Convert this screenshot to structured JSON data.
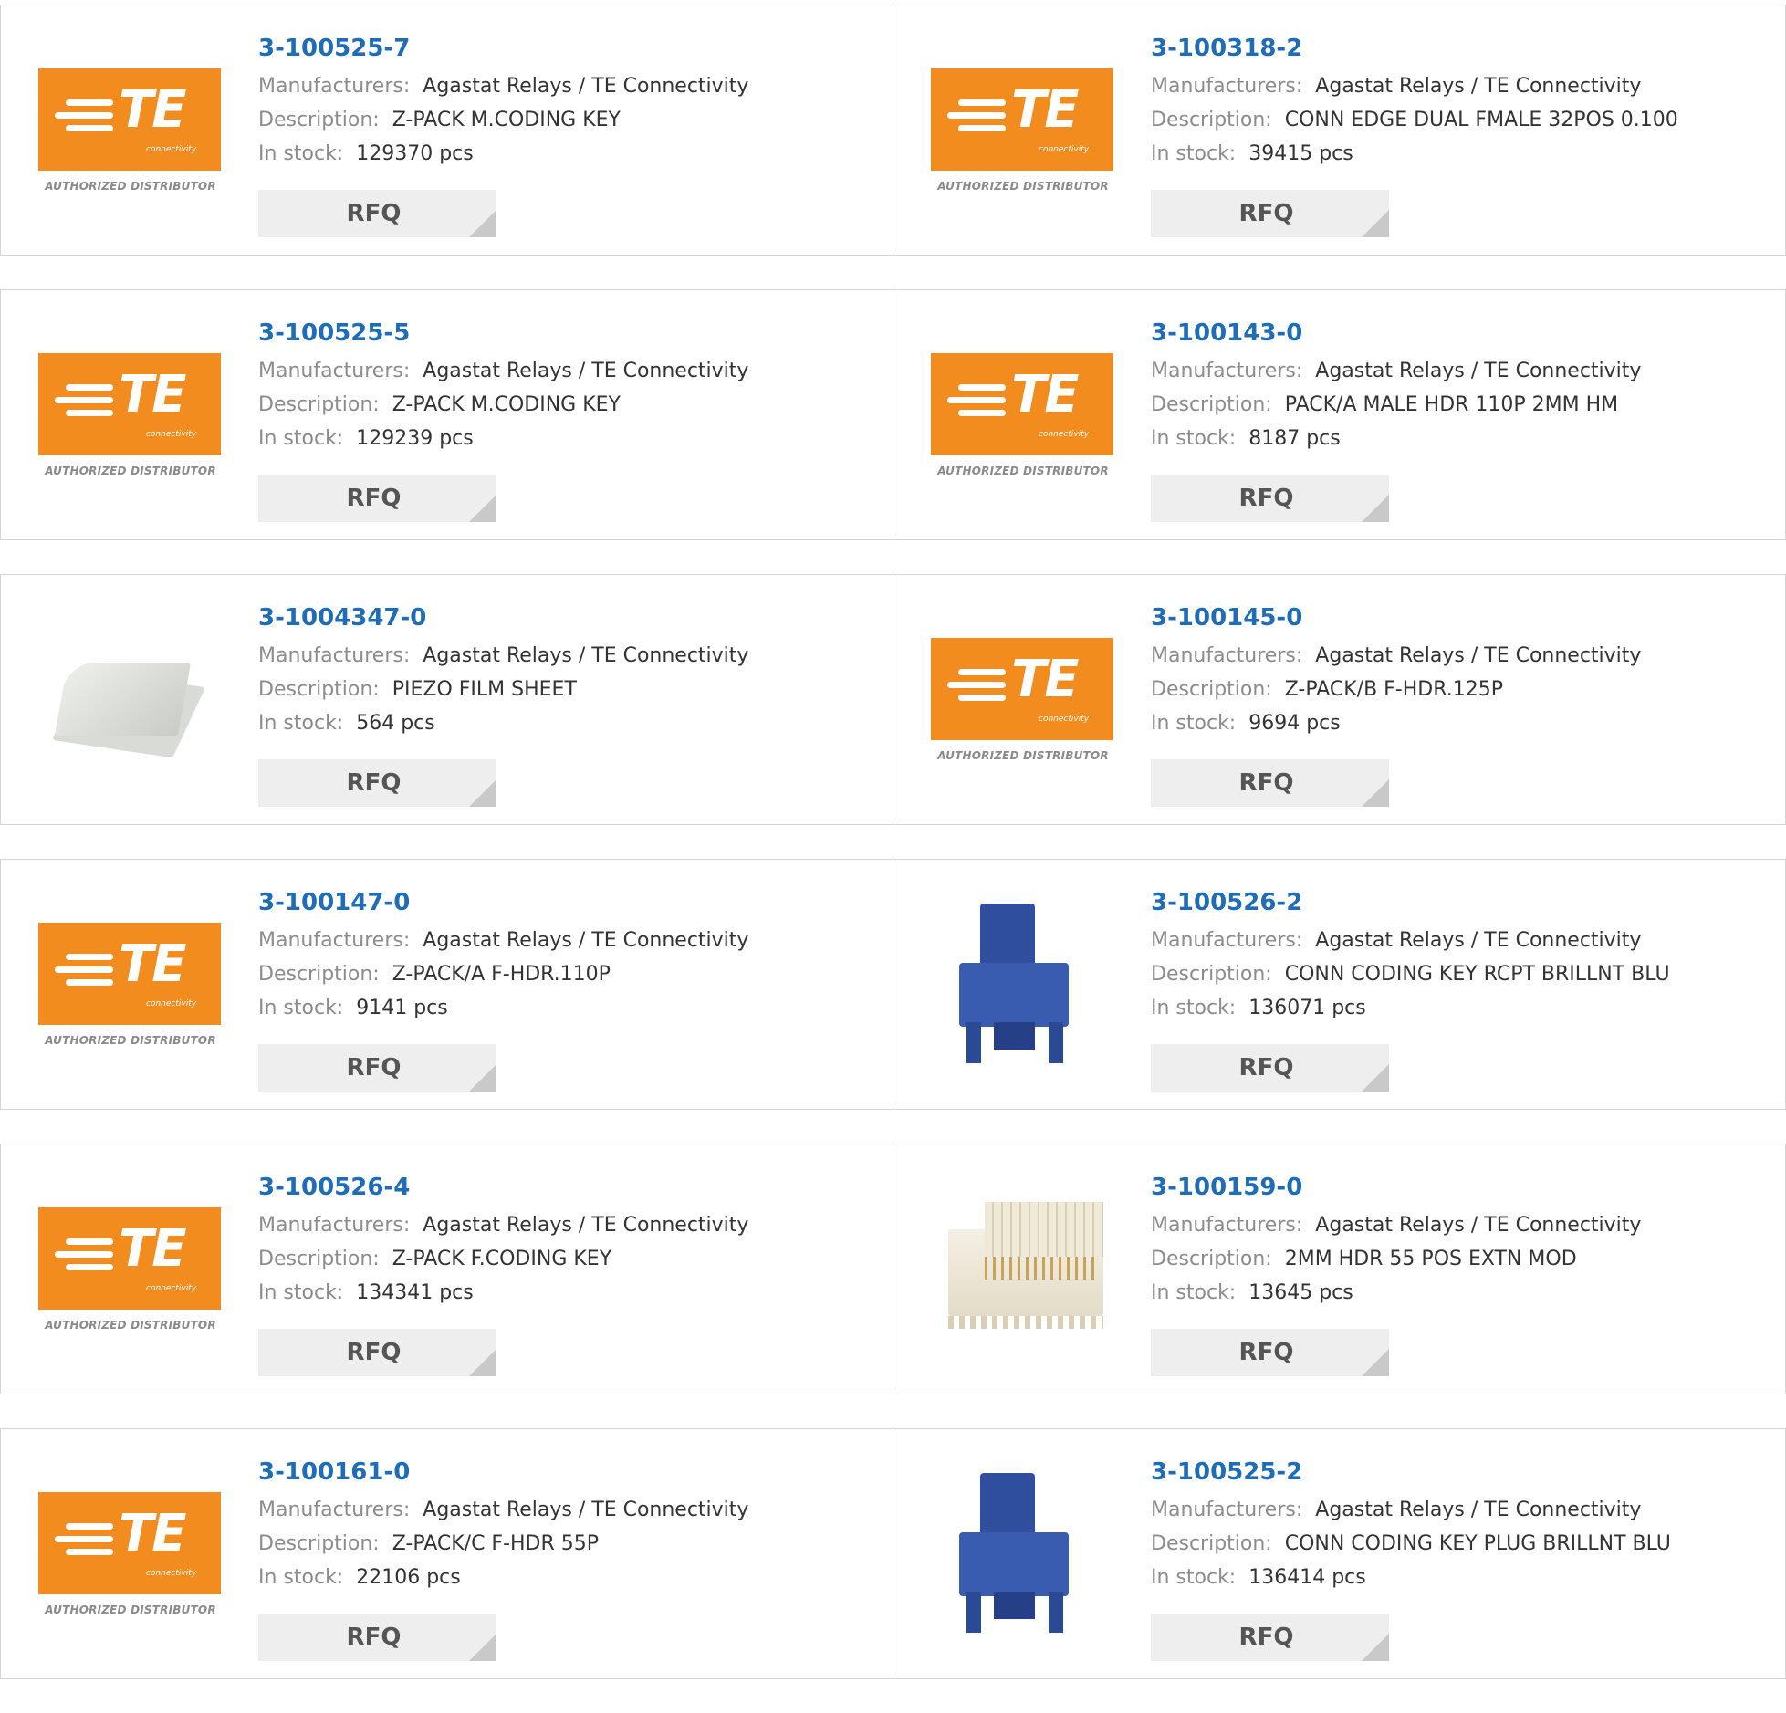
{
  "labels": {
    "manufacturers": "Manufacturers:",
    "description": "Description:",
    "in_stock": "In stock:",
    "rfq": "RFQ"
  },
  "logo": {
    "brand": "TE",
    "tagline": "connectivity",
    "authorized": "AUTHORIZED DISTRIBUTOR"
  },
  "colors": {
    "part_link": "#1f6db6",
    "te_orange": "#f28c1f",
    "rfq_bg": "#eeeeee"
  },
  "products": [
    {
      "part": "3-100525-7",
      "manufacturer": "Agastat Relays / TE Connectivity",
      "description": "Z-PACK M.CODING KEY",
      "stock": "129370 pcs",
      "image": "te-logo"
    },
    {
      "part": "3-100318-2",
      "manufacturer": "Agastat Relays / TE Connectivity",
      "description": "CONN EDGE DUAL FMALE 32POS 0.100",
      "stock": "39415 pcs",
      "image": "te-logo"
    },
    {
      "part": "3-100525-5",
      "manufacturer": "Agastat Relays / TE Connectivity",
      "description": "Z-PACK M.CODING KEY",
      "stock": "129239 pcs",
      "image": "te-logo"
    },
    {
      "part": "3-100143-0",
      "manufacturer": "Agastat Relays / TE Connectivity",
      "description": "PACK/A MALE HDR 110P 2MM HM",
      "stock": "8187 pcs",
      "image": "te-logo"
    },
    {
      "part": "3-1004347-0",
      "manufacturer": "Agastat Relays / TE Connectivity",
      "description": "PIEZO FILM SHEET",
      "stock": "564 pcs",
      "image": "piezo-film-photo"
    },
    {
      "part": "3-100145-0",
      "manufacturer": "Agastat Relays / TE Connectivity",
      "description": "Z-PACK/B F-HDR.125P",
      "stock": "9694 pcs",
      "image": "te-logo"
    },
    {
      "part": "3-100147-0",
      "manufacturer": "Agastat Relays / TE Connectivity",
      "description": "Z-PACK/A F-HDR.110P",
      "stock": "9141 pcs",
      "image": "te-logo"
    },
    {
      "part": "3-100526-2",
      "manufacturer": "Agastat Relays / TE Connectivity",
      "description": "CONN CODING KEY RCPT BRILLNT BLU",
      "stock": "136071 pcs",
      "image": "blue-coding-key-photo"
    },
    {
      "part": "3-100526-4",
      "manufacturer": "Agastat Relays / TE Connectivity",
      "description": "Z-PACK F.CODING KEY",
      "stock": "134341 pcs",
      "image": "te-logo"
    },
    {
      "part": "3-100159-0",
      "manufacturer": "Agastat Relays / TE Connectivity",
      "description": "2MM HDR 55 POS EXTN MOD",
      "stock": "13645 pcs",
      "image": "header-connector-photo"
    },
    {
      "part": "3-100161-0",
      "manufacturer": "Agastat Relays / TE Connectivity",
      "description": "Z-PACK/C F-HDR 55P",
      "stock": "22106 pcs",
      "image": "te-logo"
    },
    {
      "part": "3-100525-2",
      "manufacturer": "Agastat Relays / TE Connectivity",
      "description": "CONN CODING KEY PLUG BRILLNT BLU",
      "stock": "136414 pcs",
      "image": "blue-coding-key-photo"
    }
  ]
}
